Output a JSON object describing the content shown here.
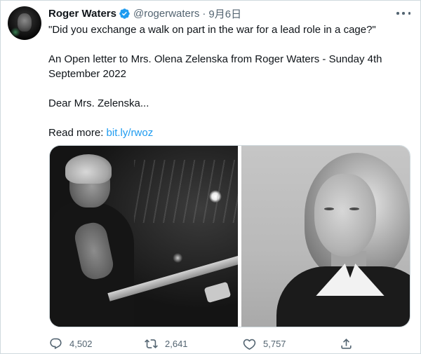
{
  "tweet": {
    "author_name": "Roger Waters",
    "handle": "@rogerwaters",
    "separator": "·",
    "date": "9月6日",
    "lines": [
      "\"Did you exchange a walk on part in the war for a lead role in a cage?\"",
      "An Open letter to Mrs. Olena Zelenska from Roger Waters - Sunday 4th September 2022",
      "Dear Mrs. Zelenska..."
    ],
    "read_more_label": "Read more: ",
    "read_more_link": "bit.ly/rwoz"
  },
  "actions": {
    "replies": "4,502",
    "retweets": "2,641",
    "likes": "5,757"
  },
  "icons": {
    "verified": "verified-badge-icon",
    "more": "more-icon",
    "reply": "reply-icon",
    "retweet": "retweet-icon",
    "like": "heart-icon",
    "share": "share-icon"
  },
  "colors": {
    "accent": "#1d9bf0",
    "text": "#0f1419",
    "secondary": "#536471"
  }
}
